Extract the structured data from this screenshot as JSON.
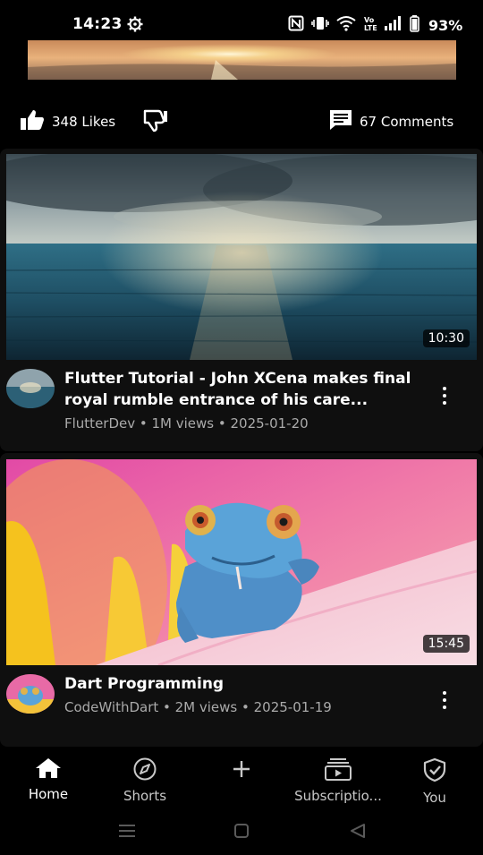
{
  "status_bar": {
    "time": "14:23",
    "battery_percent": "93%",
    "icons": [
      "settings-gear-icon",
      "nfc-icon",
      "vibrate-icon",
      "wifi-icon",
      "volte-icon",
      "signal-icon",
      "battery-icon"
    ]
  },
  "actions": {
    "likes": "348 Likes",
    "comments": "67 Comments"
  },
  "videos": [
    {
      "title": "Flutter Tutorial - John XCena makes final royal rumble entrance of his care...",
      "channel": "FlutterDev",
      "meta": "FlutterDev • 1M views • 2025-01-20",
      "duration": "10:30"
    },
    {
      "title": "Dart Programming",
      "channel": "CodeWithDart",
      "meta": "CodeWithDart • 2M views • 2025-01-19",
      "duration": "15:45"
    }
  ],
  "bottom_nav": {
    "items": [
      {
        "label": "Home",
        "icon": "home-icon",
        "active": true
      },
      {
        "label": "Shorts",
        "icon": "compass-icon",
        "active": false
      },
      {
        "label": "",
        "icon": "plus-icon",
        "active": false
      },
      {
        "label": "Subscriptio...",
        "icon": "subscriptions-icon",
        "active": false
      },
      {
        "label": "You",
        "icon": "shield-check-icon",
        "active": false
      }
    ]
  },
  "system_nav": {
    "buttons": [
      "recents-menu-icon",
      "home-square-icon",
      "back-triangle-icon"
    ]
  },
  "colors": {
    "background": "#000000",
    "card": "#0f0f0f",
    "secondary_text": "#aaaaaa"
  }
}
